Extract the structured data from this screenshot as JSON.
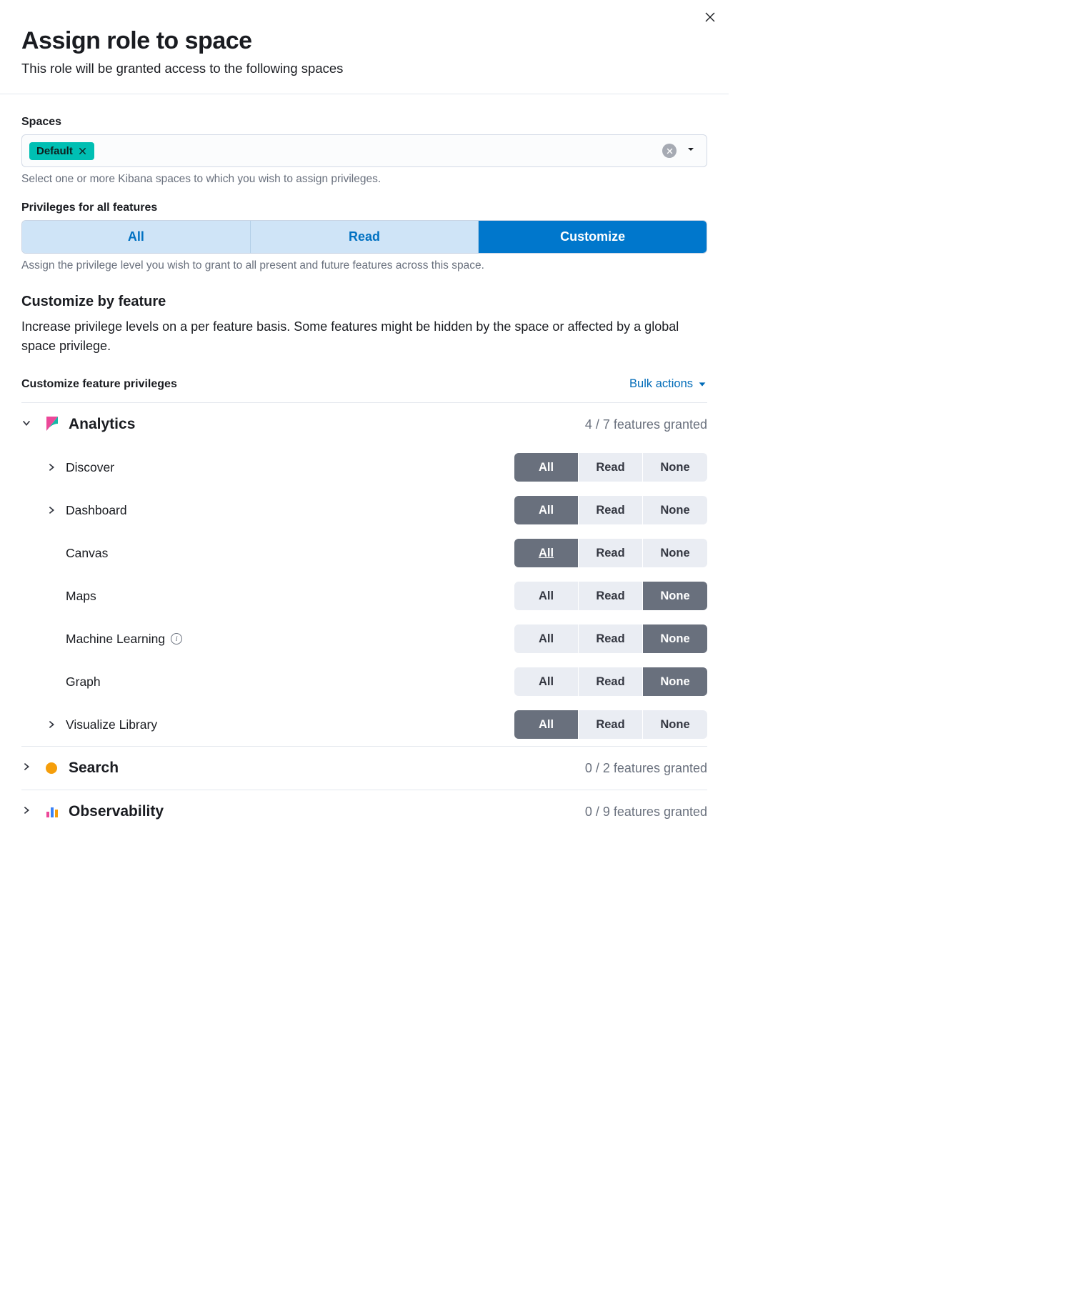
{
  "header": {
    "title": "Assign role to space",
    "subtitle": "This role will be granted access to the following spaces"
  },
  "spaces": {
    "label": "Spaces",
    "tags": [
      "Default"
    ],
    "help_text": "Select one or more Kibana spaces to which you wish to assign privileges."
  },
  "privileges_all": {
    "label": "Privileges for all features",
    "options": [
      "All",
      "Read",
      "Customize"
    ],
    "selected": "Customize",
    "help_text": "Assign the privilege level you wish to grant to all present and future features across this space."
  },
  "customize": {
    "heading": "Customize by feature",
    "description": "Increase privilege levels on a per feature basis. Some features might be hidden by the space or affected by a global space privilege."
  },
  "feature_priv": {
    "label": "Customize feature privileges",
    "bulk_label": "Bulk actions"
  },
  "priv_options": {
    "all": "All",
    "read": "Read",
    "none": "None"
  },
  "categories": [
    {
      "name": "Analytics",
      "icon": "kibana",
      "expanded": true,
      "status": "4 / 7 features granted",
      "features": [
        {
          "name": "Discover",
          "expandable": true,
          "selected": "all",
          "underline": false
        },
        {
          "name": "Dashboard",
          "expandable": true,
          "selected": "all",
          "underline": false
        },
        {
          "name": "Canvas",
          "expandable": false,
          "selected": "all",
          "underline": true
        },
        {
          "name": "Maps",
          "expandable": false,
          "selected": "none",
          "underline": false
        },
        {
          "name": "Machine Learning",
          "expandable": false,
          "info": true,
          "selected": "none",
          "underline": false
        },
        {
          "name": "Graph",
          "expandable": false,
          "selected": "none",
          "underline": false
        },
        {
          "name": "Visualize Library",
          "expandable": true,
          "selected": "all",
          "underline": false
        }
      ]
    },
    {
      "name": "Search",
      "icon": "search",
      "expanded": false,
      "status": "0 / 2 features granted",
      "features": []
    },
    {
      "name": "Observability",
      "icon": "observability",
      "expanded": false,
      "status": "0 / 9 features granted",
      "features": []
    }
  ]
}
